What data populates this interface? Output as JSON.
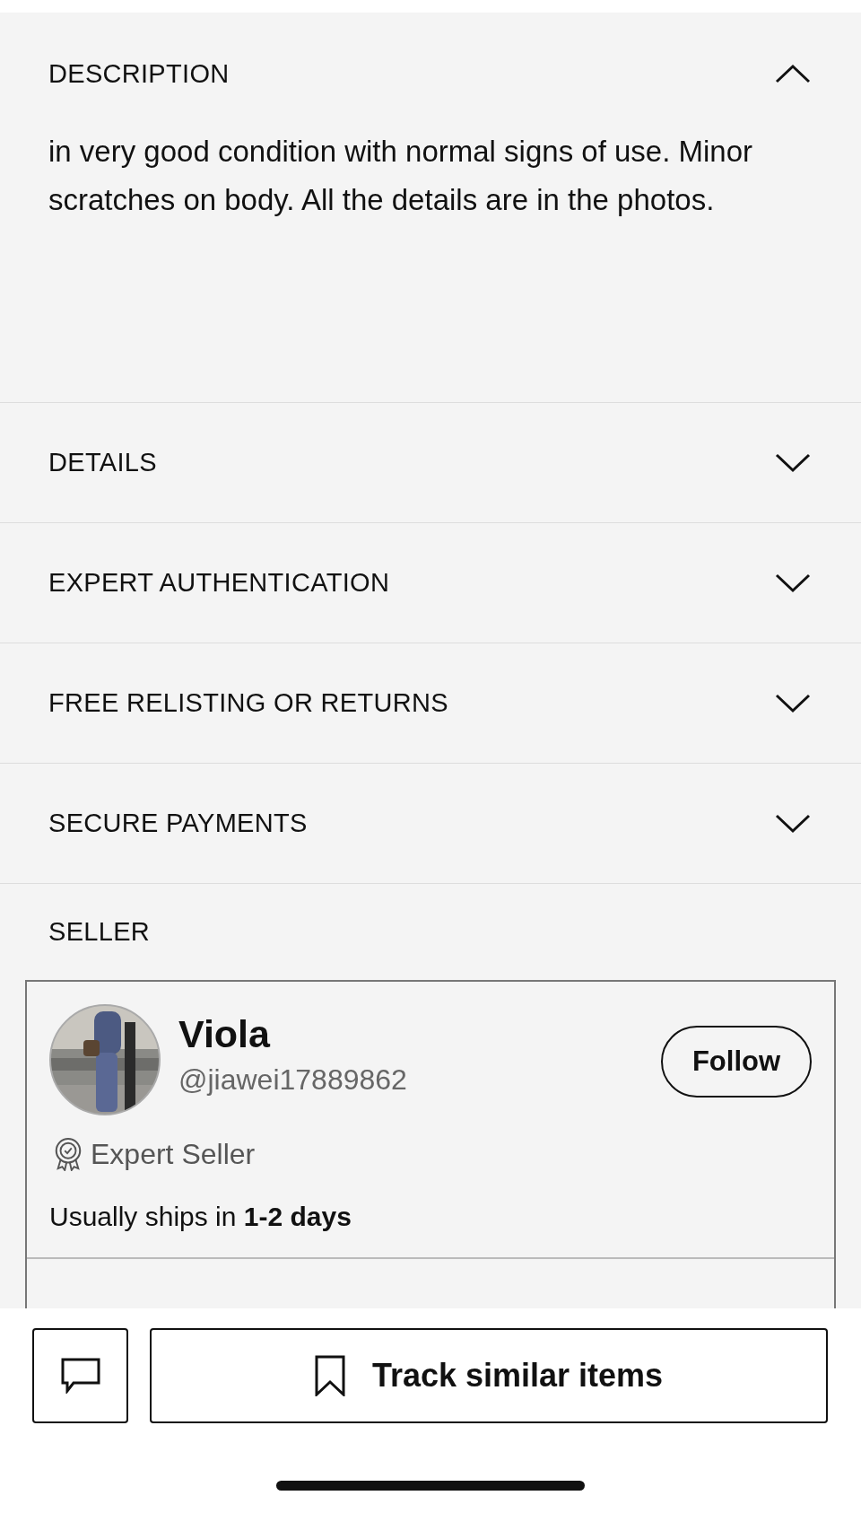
{
  "sections": [
    {
      "title": "DESCRIPTION",
      "expanded": true,
      "body": "in very good condition with normal signs of use. Minor scratches on body. All the details are in the photos."
    },
    {
      "title": "DETAILS",
      "expanded": false
    },
    {
      "title": "EXPERT AUTHENTICATION",
      "expanded": false
    },
    {
      "title": "FREE RELISTING OR RETURNS",
      "expanded": false
    },
    {
      "title": "SECURE PAYMENTS",
      "expanded": false
    }
  ],
  "seller": {
    "heading": "SELLER",
    "name": "Viola",
    "handle": "@jiawei17889862",
    "badge": "Expert Seller",
    "shipping": "Usually ships in **1-2 days**",
    "follow_button": "Follow"
  },
  "bottom_bar": {
    "track_button": "Track similar items"
  }
}
